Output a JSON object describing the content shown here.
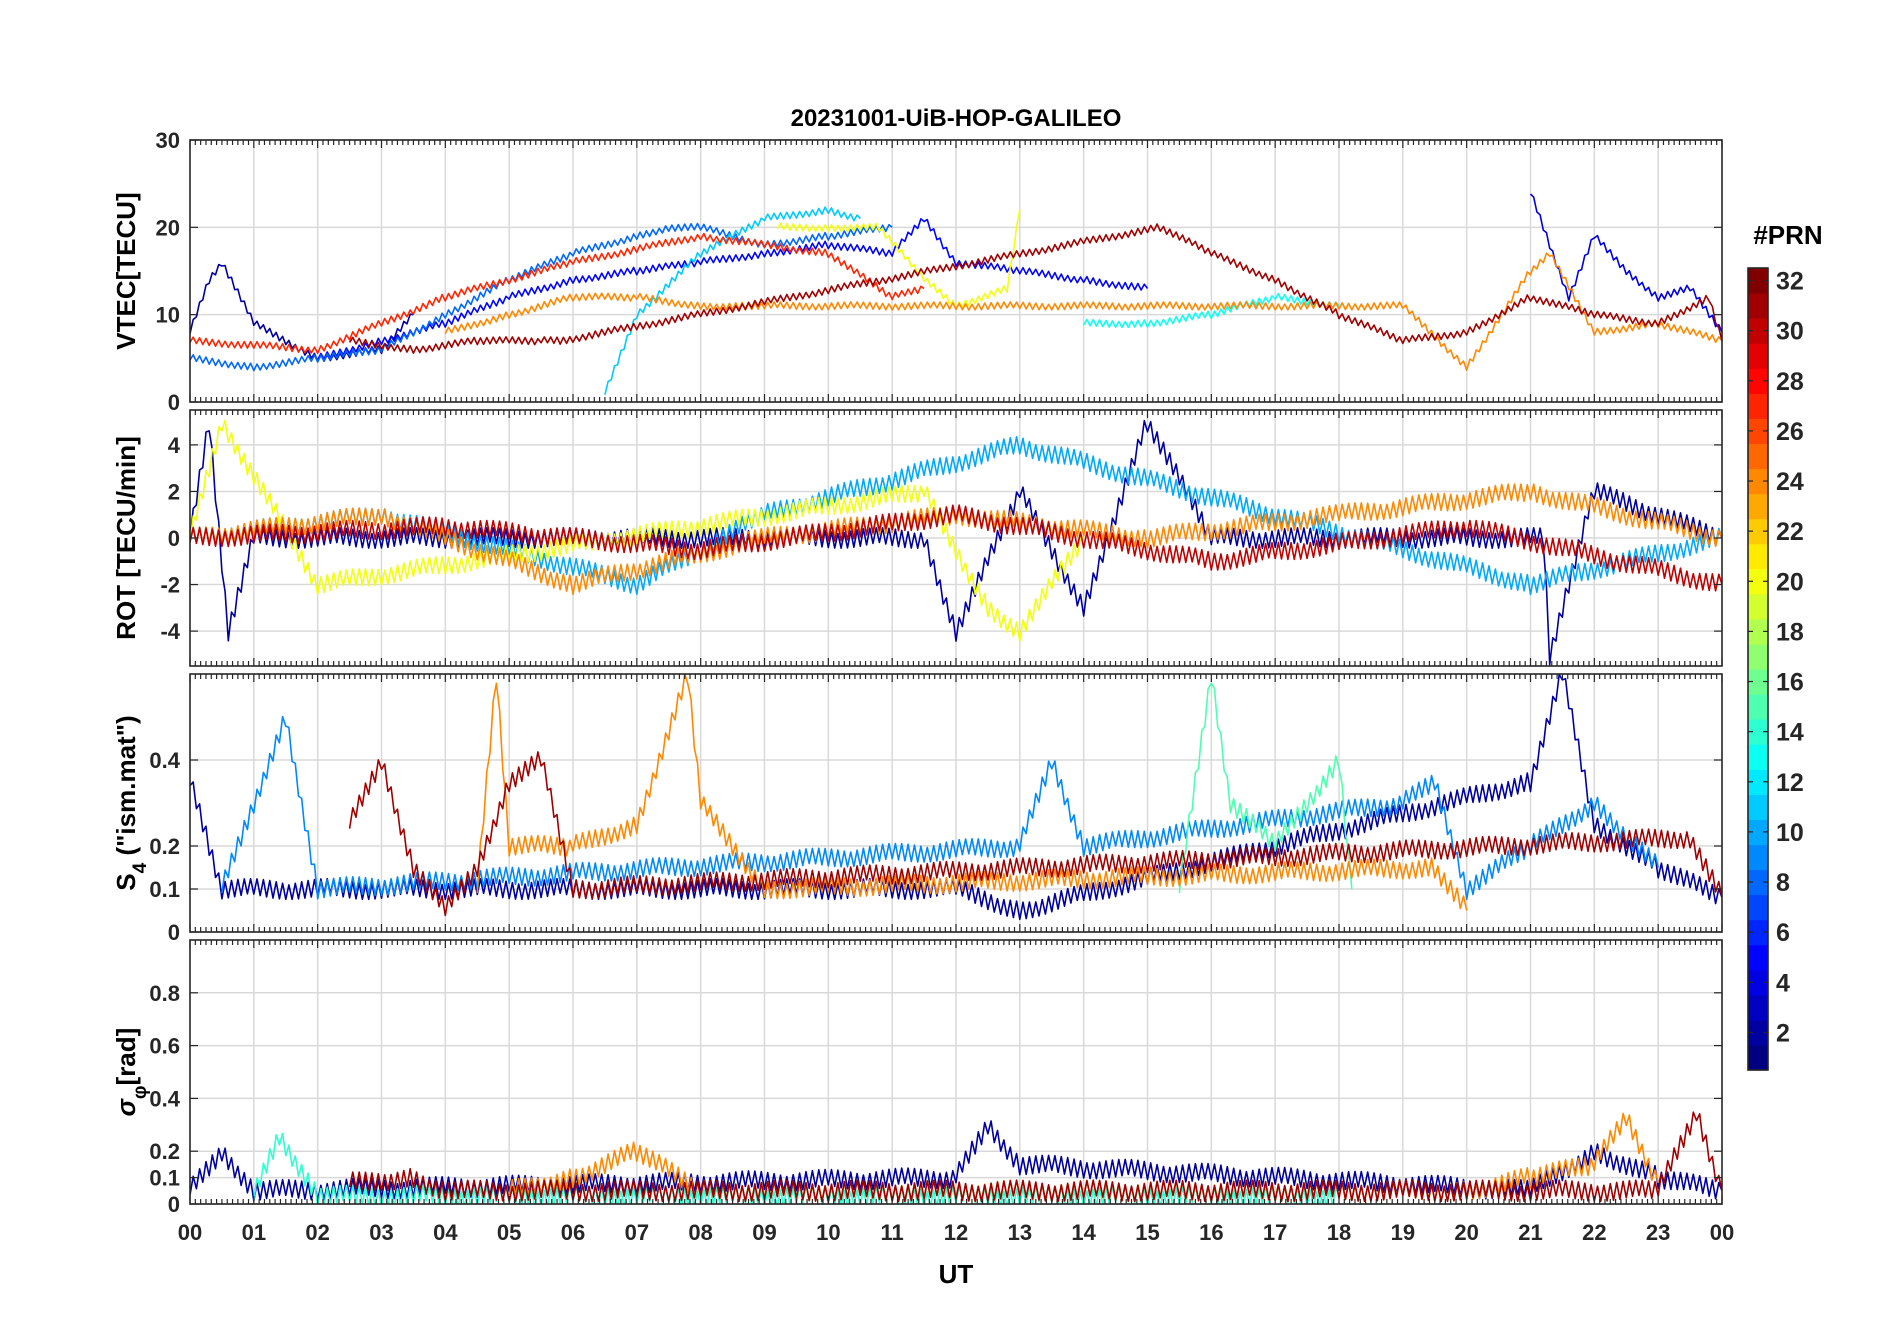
{
  "chart_data": {
    "type": "line",
    "title": "20231001-UiB-HOP-GALILEO",
    "xlabel": "UT",
    "x_ticks": [
      "00",
      "01",
      "02",
      "03",
      "04",
      "05",
      "06",
      "07",
      "08",
      "09",
      "10",
      "11",
      "12",
      "13",
      "14",
      "15",
      "16",
      "17",
      "18",
      "19",
      "20",
      "21",
      "22",
      "23",
      "00"
    ],
    "xlim_hours": [
      0,
      24
    ],
    "grid": true,
    "colorbar": {
      "label": "#PRN",
      "range": [
        1,
        32
      ],
      "ticks": [
        "2",
        "4",
        "6",
        "8",
        "10",
        "12",
        "14",
        "16",
        "18",
        "20",
        "22",
        "24",
        "26",
        "28",
        "30",
        "32"
      ],
      "colormap": "jet"
    },
    "panels": [
      {
        "id": "vtec",
        "ylabel": "VTEC[TECU]",
        "ylim": [
          0,
          30
        ],
        "yticks": [
          "0",
          "10",
          "20",
          "30"
        ],
        "series": [
          {
            "prn": 2,
            "x": [
              0,
              0.3,
              0.5,
              1,
              2,
              3,
              3.5
            ],
            "y": [
              8,
              14,
              16,
              9,
              5,
              6,
              10
            ]
          },
          {
            "prn": 5,
            "x": [
              2,
              3,
              4,
              5,
              6,
              7,
              8,
              9,
              10,
              11,
              11.5,
              12,
              13,
              14,
              15
            ],
            "y": [
              5,
              7,
              9,
              12,
              14,
              15,
              16,
              17,
              18,
              17,
              21,
              16,
              15,
              14,
              13
            ]
          },
          {
            "prn": 8,
            "x": [
              0,
              1,
              2,
              3,
              4,
              5,
              6,
              7,
              7.5,
              8,
              9,
              10,
              11
            ],
            "y": [
              5,
              4,
              5,
              6,
              10,
              14,
              17,
              19,
              20,
              20,
              18,
              19,
              20
            ]
          },
          {
            "prn": 4,
            "x": [
              21,
              21.3,
              21.6,
              22,
              22.5,
              23,
              23.5,
              24
            ],
            "y": [
              24,
              18,
              12,
              19,
              15,
              12,
              13,
              8
            ]
          },
          {
            "prn": 11,
            "x": [
              6.5,
              7,
              8,
              9,
              10,
              10.5
            ],
            "y": [
              1,
              10,
              17,
              21,
              22,
              21
            ]
          },
          {
            "prn": 13,
            "x": [
              14,
              15,
              16,
              17,
              18
            ],
            "y": [
              9,
              9,
              10,
              12,
              11
            ]
          },
          {
            "prn": 20,
            "x": [
              9.2,
              10,
              10.8,
              11.5,
              12,
              12.8,
              13
            ],
            "y": [
              20,
              20,
              20,
              14,
              11,
              13,
              22
            ]
          },
          {
            "prn": 24,
            "x": [
              4,
              5,
              6,
              7,
              8,
              8.7,
              19,
              20,
              21,
              21.3,
              22,
              23,
              24
            ],
            "y": [
              8,
              10,
              12,
              12,
              11,
              11,
              11,
              4,
              15,
              17,
              8,
              9,
              7
            ]
          },
          {
            "prn": 27,
            "x": [
              0,
              2,
              4,
              6,
              8,
              10,
              11,
              11.5
            ],
            "y": [
              7,
              6,
              12,
              16,
              19,
              17,
              12,
              13
            ]
          },
          {
            "prn": 31,
            "x": [
              2.5,
              3.5,
              4.5,
              5.5,
              5.8,
              15.2,
              16,
              17,
              18,
              19,
              20,
              21,
              22,
              23,
              23.8,
              24
            ],
            "y": [
              7,
              6,
              7,
              7,
              7,
              20,
              17,
              14,
              10,
              7,
              8,
              12,
              10,
              9,
              12,
              7
            ]
          }
        ]
      },
      {
        "id": "rot",
        "ylabel": "ROT [TECU/min]",
        "ylim": [
          -5.5,
          5.5
        ],
        "yticks": [
          "-4",
          "-2",
          "0",
          "2",
          "4"
        ],
        "series": [
          {
            "prn": 2,
            "x": [
              0,
              0.3,
              0.6,
              1,
              11.5,
              12,
              13,
              14,
              15,
              16,
              21.2,
              21.3,
              22,
              24
            ],
            "y": [
              0,
              5,
              -4,
              0,
              0,
              -4,
              2,
              -3,
              5,
              0,
              0,
              -5,
              2,
              0
            ]
          },
          {
            "prn": 10,
            "x": [
              0,
              3,
              7,
              9,
              13,
              21,
              24
            ],
            "y": [
              0,
              1,
              -2,
              1,
              4,
              -2,
              0
            ]
          },
          {
            "prn": 20,
            "x": [
              0,
              0.5,
              2,
              11.5,
              12.5,
              13,
              14
            ],
            "y": [
              0,
              5,
              -2,
              2,
              -3,
              -4,
              0
            ]
          },
          {
            "prn": 24,
            "x": [
              0,
              3,
              6,
              9,
              12,
              15,
              18,
              21,
              24
            ],
            "y": [
              0,
              1,
              -2,
              0,
              1,
              0,
              1,
              2,
              0
            ]
          },
          {
            "prn": 30,
            "x": [
              0,
              4,
              8,
              12,
              16,
              20,
              24
            ],
            "y": [
              0,
              0.5,
              -0.5,
              1,
              -1,
              0.5,
              -2
            ]
          }
        ]
      },
      {
        "id": "s4",
        "ylabel_main": "S",
        "ylabel_sub": "4",
        "ylabel_tail": " (\"ism.mat\")",
        "ylim": [
          0,
          0.6
        ],
        "yticks": [
          "0",
          "0.1",
          "0.2",
          "0.4"
        ],
        "series": [
          {
            "prn": 2,
            "x": [
              0,
              0.3,
              0.5,
              12,
              13,
              21,
              21.5,
              22,
              23,
              24
            ],
            "y": [
              0.35,
              0.2,
              0.1,
              0.1,
              0.05,
              0.35,
              0.6,
              0.25,
              0.15,
              0.08
            ]
          },
          {
            "prn": 9,
            "x": [
              0.5,
              1.5,
              2,
              13,
              13.5,
              14,
              19,
              19.5,
              20,
              21,
              22,
              23
            ],
            "y": [
              0.1,
              0.5,
              0.1,
              0.2,
              0.4,
              0.2,
              0.3,
              0.35,
              0.1,
              0.2,
              0.3,
              0.15
            ]
          },
          {
            "prn": 15,
            "x": [
              15.5,
              16,
              16.3,
              17,
              18,
              18.2
            ],
            "y": [
              0.1,
              0.6,
              0.3,
              0.2,
              0.4,
              0.1
            ]
          },
          {
            "prn": 24,
            "x": [
              4.5,
              4.8,
              5,
              6,
              7,
              7.8,
              8,
              9,
              19.5,
              20
            ],
            "y": [
              0.1,
              0.6,
              0.2,
              0.2,
              0.25,
              0.6,
              0.3,
              0.1,
              0.15,
              0.05
            ]
          },
          {
            "prn": 31,
            "x": [
              2.5,
              3,
              3.5,
              4,
              4.5,
              5,
              5.5,
              6,
              23.5,
              24
            ],
            "y": [
              0.25,
              0.4,
              0.15,
              0.05,
              0.15,
              0.35,
              0.4,
              0.1,
              0.22,
              0.08
            ]
          }
        ]
      },
      {
        "id": "sigma",
        "ylabel_main": "σ",
        "ylabel_sub": "φ",
        "ylabel_tail": "[rad]",
        "ylim": [
          0,
          1
        ],
        "yticks": [
          "0",
          "0.1",
          "0.2",
          "0.4",
          "0.6",
          "0.8"
        ],
        "series": [
          {
            "prn": 2,
            "x": [
              0,
              0.5,
              1,
              12,
              12.5,
              13,
              21,
              22,
              23,
              24
            ],
            "y": [
              0.05,
              0.2,
              0.05,
              0.1,
              0.3,
              0.15,
              0.05,
              0.2,
              0.1,
              0.05
            ]
          },
          {
            "prn": 14,
            "x": [
              1,
              1.4,
              2,
              17,
              18
            ],
            "y": [
              0.03,
              0.26,
              0.03,
              0.03,
              0.03
            ]
          },
          {
            "prn": 24,
            "x": [
              5,
              6,
              7,
              8,
              20,
              21,
              22,
              22.5,
              23
            ],
            "y": [
              0.05,
              0.1,
              0.2,
              0.05,
              0.05,
              0.1,
              0.15,
              0.33,
              0.08
            ]
          },
          {
            "prn": 31,
            "x": [
              2.5,
              3.5,
              4,
              23,
              23.6,
              24
            ],
            "y": [
              0.08,
              0.1,
              0.05,
              0.05,
              0.35,
              0.05
            ]
          }
        ]
      }
    ]
  }
}
